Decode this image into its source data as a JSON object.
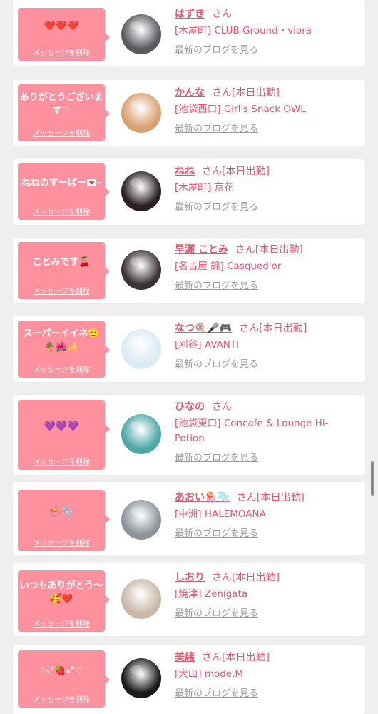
{
  "delete_label": "メッセージを削除",
  "san_label": "さん",
  "blog_label": "最新のブログを見る",
  "colors": {
    "accent": "#e8546d",
    "bubble": "#ff919e",
    "background": "#efefef"
  },
  "cards": [
    {
      "message": "❤️❤️❤️",
      "name": "はずき",
      "status": "",
      "shop": "[木屋町] CLUB Ground・viora",
      "avatar_color": "#5b5a5f"
    },
    {
      "message": "ありがとうございます♡",
      "name": "かんな",
      "status": "[本日出勤]",
      "shop": "[池袋西口] Girl's Snack OWL",
      "avatar_color": "#d9a070"
    },
    {
      "message": "ねねのすーぱー💌-",
      "name": "ねね",
      "status": "[本日出勤]",
      "shop": "[木屋町] 京花",
      "avatar_color": "#2b1f24"
    },
    {
      "message": "ことみです🍒",
      "name": "早瀬 ことみ",
      "status": "[本日出勤]",
      "shop": "[名古屋 錦] Casqued'or",
      "avatar_color": "#3a3331"
    },
    {
      "message": "スーパーイイネ🫡🌴🌺✨",
      "name": "なつ🍭🎤🎮",
      "status": "[本日出勤]",
      "shop": "[刈谷] AVANTI",
      "avatar_color": "#dbeaf4"
    },
    {
      "message": "💜💜💜",
      "name": "ひなの",
      "status": "",
      "shop": "[池袋東口] Concafe & Lounge Hi-Potion",
      "avatar_color": "#4fa8a8"
    },
    {
      "message": "🪼🫧",
      "name": "あおい🪼🫧",
      "status": "[本日出勤]",
      "shop": "[中洲] HALEMOANA",
      "avatar_color": "#8d9499"
    },
    {
      "message": "いつもありがとう〜🥰❤️",
      "name": "しおり",
      "status": "[本日出勤]",
      "shop": "[焼津] Zenigata",
      "avatar_color": "#c9b8a8"
    },
    {
      "message": "◦ₒ°🍓ₒ°♡",
      "name": "美緒",
      "status": "[本日出勤]",
      "shop": "[犬山] mode.M",
      "avatar_color": "#1d1a1c"
    }
  ]
}
